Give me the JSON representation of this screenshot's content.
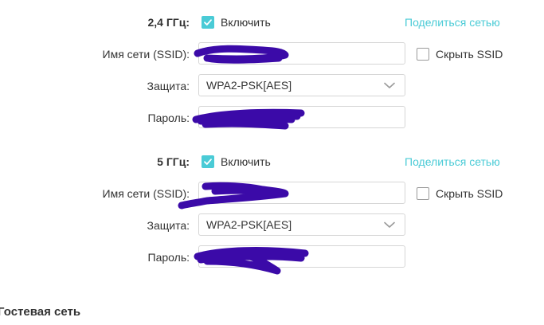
{
  "band_24": {
    "label": "2,4 ГГц:",
    "enable_label": "Включить",
    "enable_checked": true,
    "share_link": "Поделиться сетью",
    "ssid_label": "Имя сети (SSID):",
    "hide_ssid_label": "Скрыть SSID",
    "hide_ssid_checked": false,
    "security_label": "Защита:",
    "security_value": "WPA2-PSK[AES]",
    "password_label": "Пароль:"
  },
  "band_5": {
    "label": "5 ГГц:",
    "enable_label": "Включить",
    "enable_checked": true,
    "share_link": "Поделиться сетью",
    "ssid_label": "Имя сети (SSID):",
    "hide_ssid_label": "Скрыть SSID",
    "hide_ssid_checked": false,
    "security_label": "Защита:",
    "security_value": "WPA2-PSK[AES]",
    "password_label": "Пароль:"
  },
  "guest_section": {
    "title": "Гостевая сеть"
  },
  "colors": {
    "accent": "#4acbd6",
    "redaction": "#3b0aa8"
  }
}
